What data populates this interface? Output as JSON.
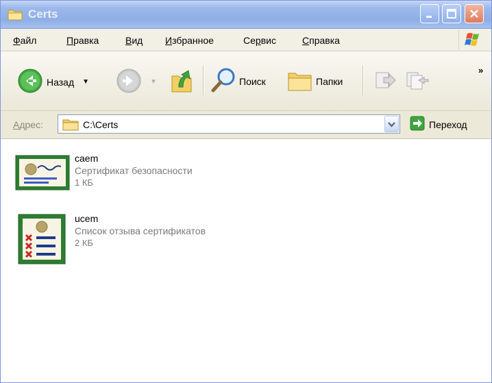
{
  "window": {
    "title": "Certs"
  },
  "menu": [
    {
      "u": "Ф",
      "rest": "айл"
    },
    {
      "u": "П",
      "rest": "равка"
    },
    {
      "u": "В",
      "rest": "ид"
    },
    {
      "u": "И",
      "rest": "збранное"
    },
    {
      "pre": "Се",
      "u": "р",
      "rest": "вис"
    },
    {
      "u": "С",
      "rest": "правка"
    }
  ],
  "toolbar": {
    "back_label": "Назад",
    "search_label": "Поиск",
    "folders_label": "Папки",
    "more": "»"
  },
  "address": {
    "label_u": "А",
    "label_rest": "дрес:",
    "value": "C:\\Certs",
    "go_label": "Переход"
  },
  "files": [
    {
      "name": "caem",
      "type": "Сертификат безопасности",
      "size": "1 КБ",
      "icon": "certificate-icon"
    },
    {
      "name": "ucem",
      "type": "Список отзыва сертификатов",
      "size": "2 КБ",
      "icon": "crl-icon"
    }
  ]
}
